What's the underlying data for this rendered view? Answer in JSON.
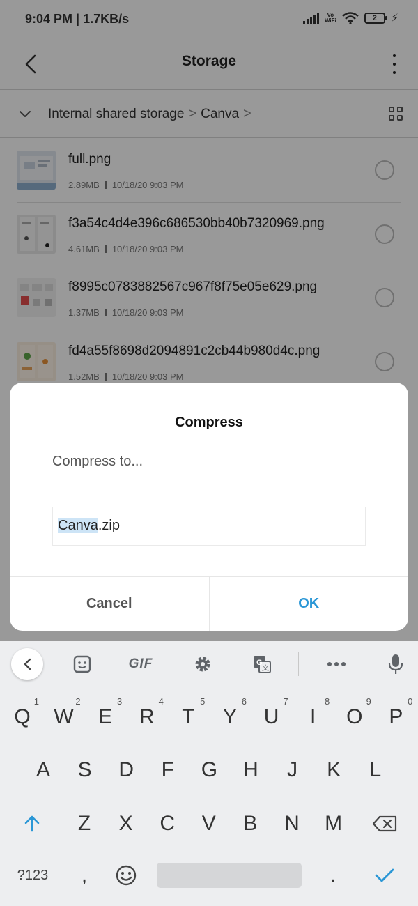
{
  "status_bar": {
    "time": "9:04 PM",
    "speed": "1.7KB/s",
    "vowifi_top": "Vo",
    "vowifi_bottom": "WiFi",
    "battery": "2"
  },
  "toolbar": {
    "title": "Storage"
  },
  "breadcrumb": {
    "items": [
      "Internal shared storage",
      "Canva"
    ],
    "separator": ">"
  },
  "files": [
    {
      "name": "full.png",
      "size": "2.89MB",
      "date": "10/18/20 9:03 PM"
    },
    {
      "name": "f3a54c4d4e396c686530bb40b7320969.png",
      "size": "4.61MB",
      "date": "10/18/20 9:03 PM"
    },
    {
      "name": "f8995c0783882567c967f8f75e05e629.png",
      "size": "1.37MB",
      "date": "10/18/20 9:03 PM"
    },
    {
      "name": "fd4a55f8698d2094891c2cb44b980d4c.png",
      "size": "1.52MB",
      "date": "10/18/20 9:03 PM"
    }
  ],
  "dialog": {
    "title": "Compress",
    "message": "Compress to...",
    "filename_selected": "Canva",
    "filename_rest": ".zip",
    "cancel_label": "Cancel",
    "ok_label": "OK"
  },
  "keyboard": {
    "gif_label": "GIF",
    "row1": [
      "Q",
      "W",
      "E",
      "R",
      "T",
      "Y",
      "U",
      "I",
      "O",
      "P"
    ],
    "row1_hints": [
      "1",
      "2",
      "3",
      "4",
      "5",
      "6",
      "7",
      "8",
      "9",
      "0"
    ],
    "row2": [
      "A",
      "S",
      "D",
      "F",
      "G",
      "H",
      "J",
      "K",
      "L"
    ],
    "row3": [
      "Z",
      "X",
      "C",
      "V",
      "B",
      "N",
      "M"
    ],
    "symbols_label": "?123",
    "comma": ",",
    "period": "."
  },
  "colors": {
    "accent": "#2b97d6",
    "selection": "#cde4f6",
    "keyboard_bg": "#edeef0",
    "scrim": "rgba(0,0,0,0.4)"
  },
  "icons": [
    "back-arrow-icon",
    "more-vert-icon",
    "chevron-down-icon",
    "grid-view-icon",
    "keyboard-collapse-icon",
    "sticker-icon",
    "settings-icon",
    "translate-icon",
    "more-dots-icon",
    "mic-icon",
    "shift-icon",
    "backspace-icon",
    "emoji-icon",
    "checkmark-icon"
  ]
}
